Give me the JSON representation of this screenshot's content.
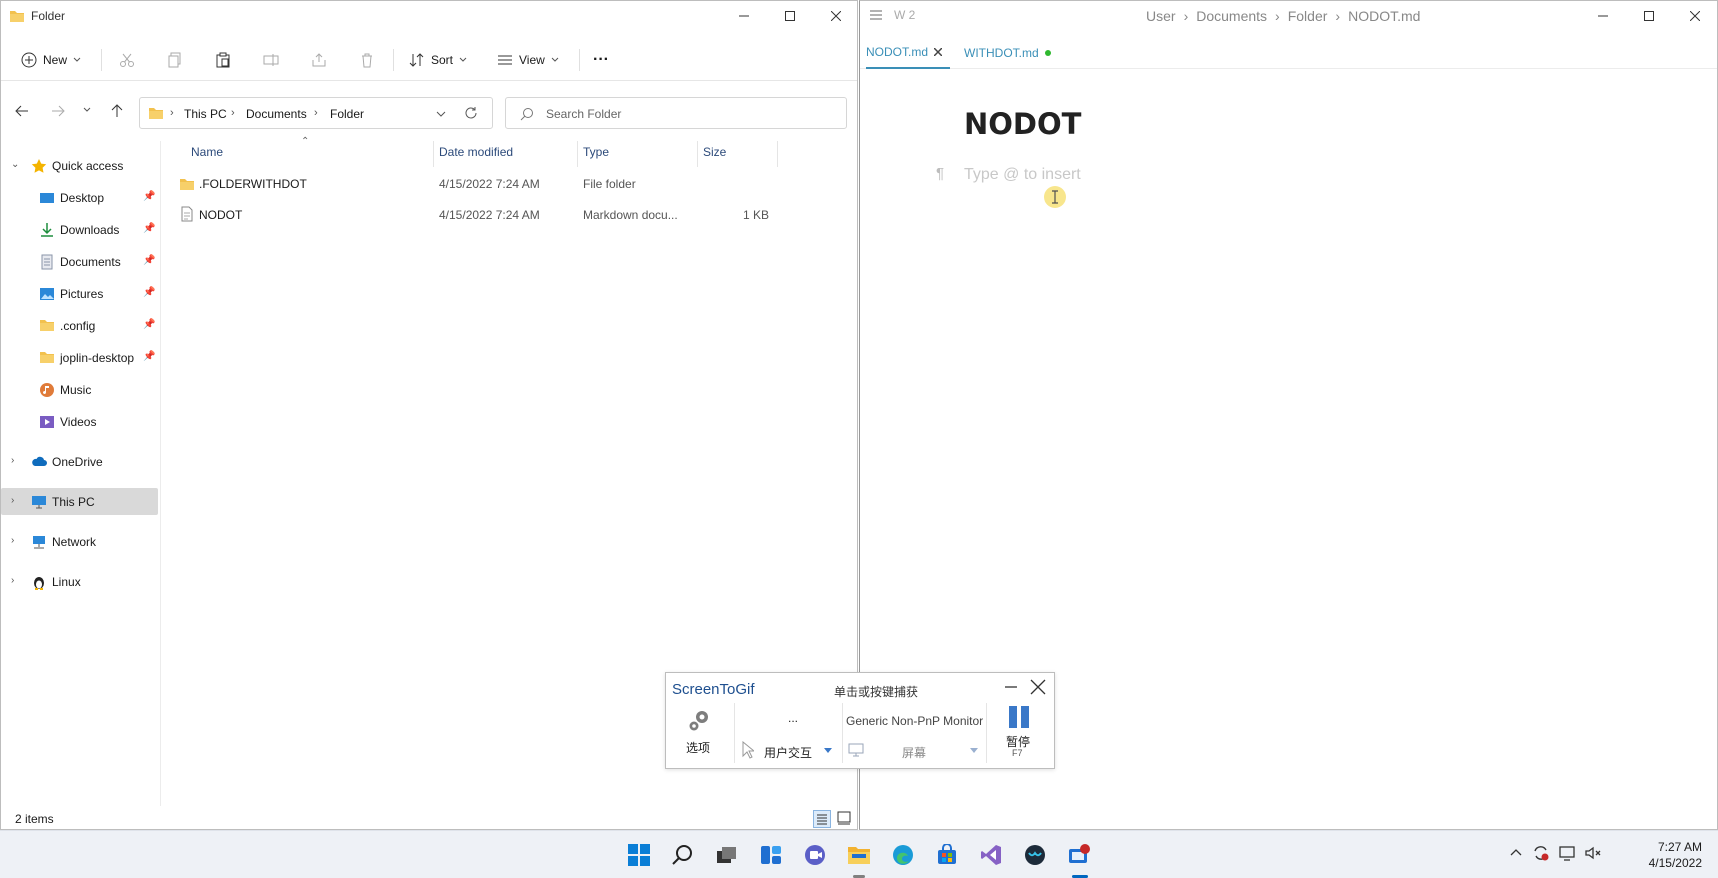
{
  "explorer": {
    "title": "Folder",
    "toolbar": {
      "new_label": "New",
      "sort_label": "Sort",
      "view_label": "View",
      "more_label": "···"
    },
    "address": [
      "This PC",
      "Documents",
      "Folder"
    ],
    "search_placeholder": "Search Folder",
    "nav": {
      "quick_access": "Quick access",
      "pinned": [
        {
          "label": "Desktop",
          "icon": "desktop-icon"
        },
        {
          "label": "Downloads",
          "icon": "downloads-icon"
        },
        {
          "label": "Documents",
          "icon": "documents-icon"
        },
        {
          "label": "Pictures",
          "icon": "pictures-icon"
        },
        {
          "label": ".config",
          "icon": "folder-icon"
        },
        {
          "label": "joplin-desktop",
          "icon": "folder-icon"
        }
      ],
      "unpinned": [
        {
          "label": "Music",
          "icon": "music-icon"
        },
        {
          "label": "Videos",
          "icon": "videos-icon"
        }
      ],
      "roots": [
        {
          "label": "OneDrive",
          "icon": "onedrive-icon"
        },
        {
          "label": "This PC",
          "icon": "this-pc-icon"
        },
        {
          "label": "Network",
          "icon": "network-icon"
        },
        {
          "label": "Linux",
          "icon": "linux-icon"
        }
      ]
    },
    "columns": {
      "name": "Name",
      "date": "Date modified",
      "type": "Type",
      "size": "Size"
    },
    "files": [
      {
        "name": ".FOLDERWITHDOT",
        "date": "4/15/2022 7:24 AM",
        "type": "File folder",
        "size": ""
      },
      {
        "name": "NODOT",
        "date": "4/15/2022 7:24 AM",
        "type": "Markdown docu...",
        "size": "1 KB"
      }
    ],
    "status": "2 items"
  },
  "editor": {
    "menu_label": "W 2",
    "breadcrumb": [
      "User",
      "Documents",
      "Folder",
      "NODOT.md"
    ],
    "tabs": [
      {
        "label": "NODOT.md"
      },
      {
        "label": "WITHDOT.md"
      }
    ],
    "doc_title": "NODOT",
    "placeholder": "Type @ to insert",
    "pilcrow": "¶"
  },
  "screentogif": {
    "title": "ScreenToGif",
    "hint": "单击或按键捕获",
    "options_label": "选项",
    "ellipsis": "...",
    "mode_label": "用户交互",
    "monitor_label": "Generic Non-PnP Monitor",
    "screen_label": "屏幕",
    "pause_label": "暂停",
    "pause_key": "F7"
  },
  "taskbar": {
    "time": "7:27 AM",
    "date": "4/15/2022"
  },
  "colors": {
    "accent": "#0067c0",
    "folder": "#f2c14e",
    "tab_active": "#3a8fb7",
    "dirty_dot": "#2eb82e"
  }
}
